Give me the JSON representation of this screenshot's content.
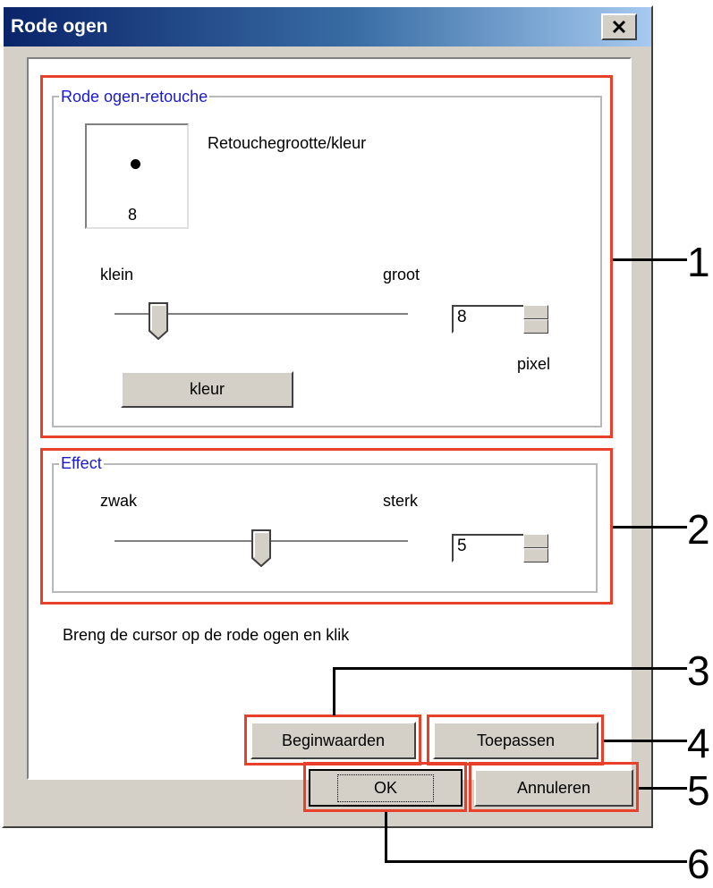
{
  "window": {
    "title": "Rode ogen",
    "close_icon": "close-icon"
  },
  "retouch_group": {
    "legend": "Rode ogen-retouche",
    "preview_size": "8",
    "size_color_label": "Retouchegrootte/kleur",
    "min_label": "klein",
    "max_label": "groot",
    "size_value": "8",
    "unit_label": "pixel",
    "color_button": "kleur",
    "slider_fraction": 0.15
  },
  "effect_group": {
    "legend": "Effect",
    "min_label": "zwak",
    "max_label": "sterk",
    "value": "5",
    "slider_fraction": 0.5
  },
  "instruction": "Breng de cursor op de rode ogen en klik",
  "buttons": {
    "defaults": "Beginwaarden",
    "apply": "Toepassen",
    "ok": "OK",
    "cancel": "Annuleren"
  },
  "callouts": [
    "1",
    "2",
    "3",
    "4",
    "5",
    "6"
  ],
  "colors": {
    "callout_box": "#e8402a",
    "legend_text": "#1a1ad0",
    "titlebar": "#0a246a"
  }
}
